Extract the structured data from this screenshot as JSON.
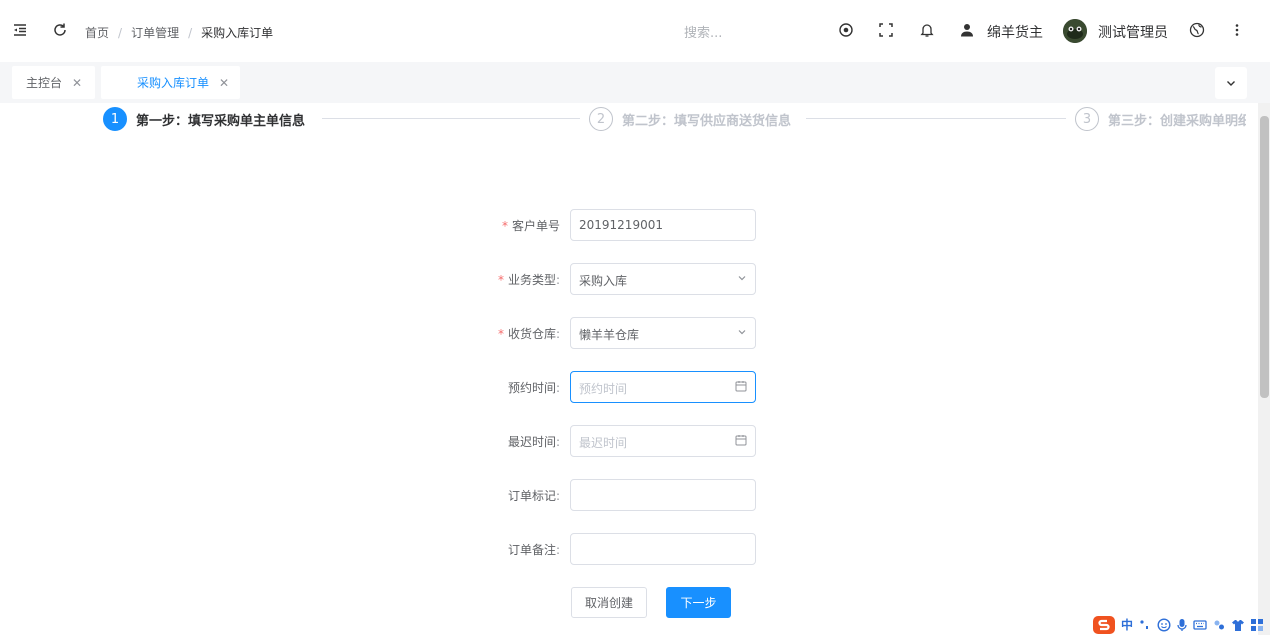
{
  "header": {
    "breadcrumb": [
      "首页",
      "订单管理",
      "采购入库订单"
    ],
    "search_placeholder": "搜索...",
    "owner_name": "绵羊货主",
    "user_name": "测试管理员"
  },
  "tabs": [
    {
      "label": "主控台",
      "active": false
    },
    {
      "label": "采购入库订单",
      "active": true
    }
  ],
  "steps": [
    {
      "number": "1",
      "title": "第一步：填写采购单主单信息",
      "active": true
    },
    {
      "number": "2",
      "title": "第二步：填写供应商送货信息",
      "active": false
    },
    {
      "number": "3",
      "title": "第三步：创建采购单明细",
      "active": false
    }
  ],
  "form": {
    "customer_no": {
      "label": "客户单号",
      "value": "20191219001"
    },
    "biz_type": {
      "label": "业务类型",
      "value": "采购入库"
    },
    "warehouse": {
      "label": "收货仓库",
      "value": "懒羊羊仓库"
    },
    "appointment_time": {
      "label": "预约时间",
      "placeholder": "预约时间"
    },
    "latest_time": {
      "label": "最迟时间",
      "placeholder": "最迟时间"
    },
    "order_mark": {
      "label": "订单标记",
      "value": ""
    },
    "order_remark": {
      "label": "订单备注",
      "value": ""
    }
  },
  "buttons": {
    "cancel": "取消创建",
    "next": "下一步"
  },
  "ime": {
    "zh_label": "中"
  },
  "colors": {
    "primary": "#1890ff",
    "required": "#f56c6c"
  }
}
